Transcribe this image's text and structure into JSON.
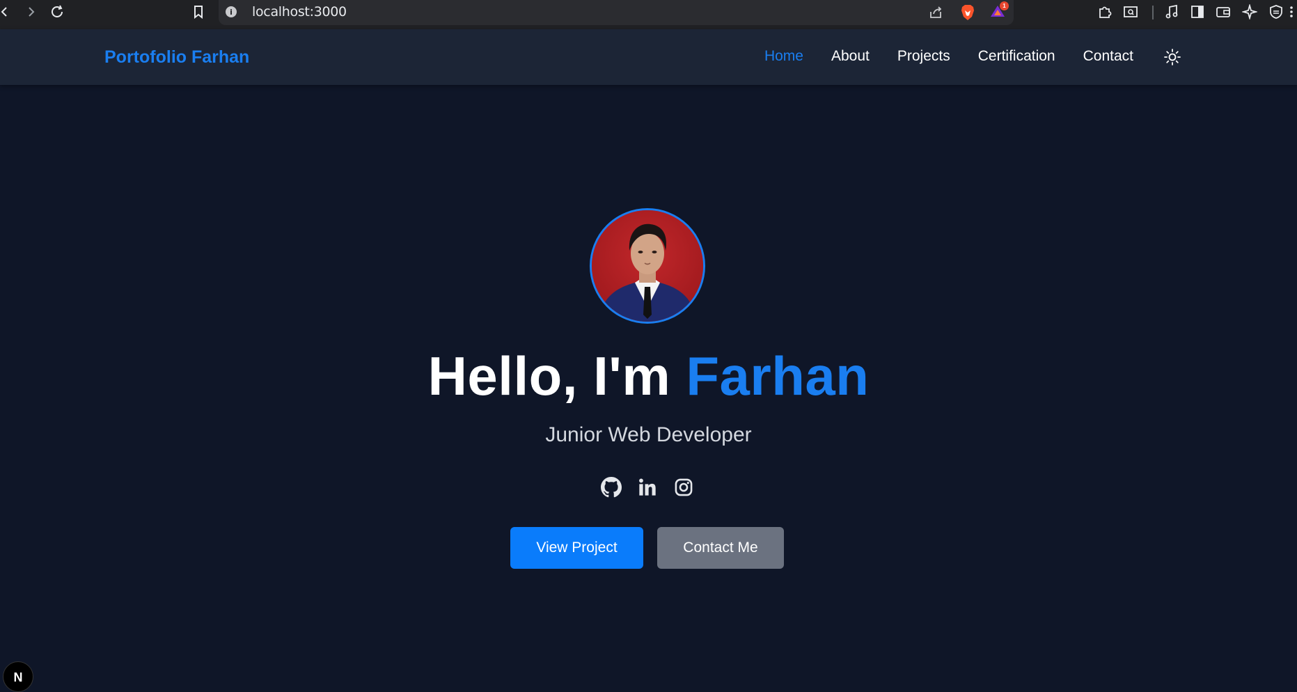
{
  "browser": {
    "url": "localhost:3000",
    "rewards_badge": "1"
  },
  "nav": {
    "brand": "Portofolio Farhan",
    "links": [
      {
        "label": "Home",
        "active": true
      },
      {
        "label": "About",
        "active": false
      },
      {
        "label": "Projects",
        "active": false
      },
      {
        "label": "Certification",
        "active": false
      },
      {
        "label": "Contact",
        "active": false
      }
    ],
    "theme_icon": "sun-icon"
  },
  "hero": {
    "greeting": "Hello, I'm ",
    "name": "Farhan",
    "subtitle": "Junior Web Developer",
    "socials": [
      "github-icon",
      "linkedin-icon",
      "instagram-icon"
    ],
    "primary_button": "View Project",
    "secondary_button": "Contact Me"
  },
  "dev_badge": "N",
  "colors": {
    "accent": "#1a7ef0",
    "background": "#0f1628",
    "navbar": "#1c2536",
    "secondary_button": "#6b7280"
  }
}
